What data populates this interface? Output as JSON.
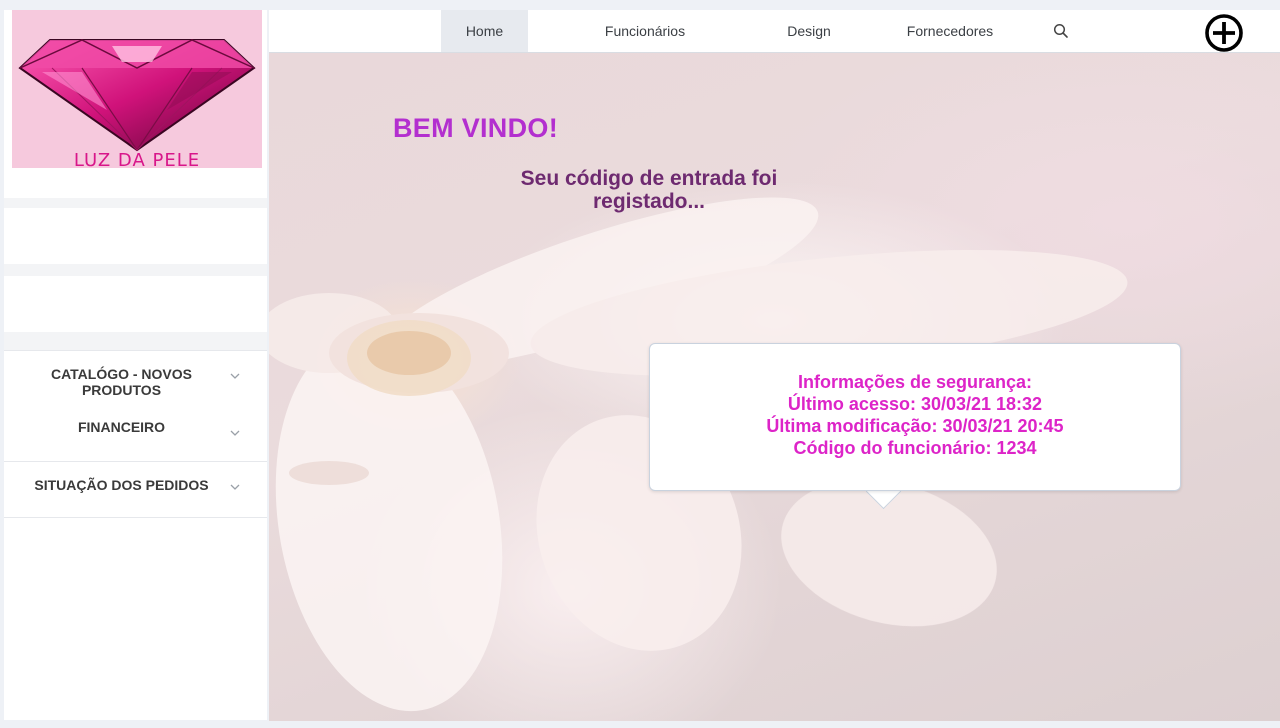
{
  "logo": {
    "text": "LUZ DA PELE"
  },
  "sidebar": {
    "items": [
      {
        "label": "CATALÓGO - NOVOS PRODUTOS"
      },
      {
        "label": "FINANCEIRO"
      },
      {
        "label": "SITUAÇÃO DOS PEDIDOS"
      }
    ]
  },
  "nav": {
    "items": [
      {
        "label": "Home",
        "active": true
      },
      {
        "label": "Funcionários"
      },
      {
        "label": "Design"
      },
      {
        "label": "Fornecedores"
      }
    ],
    "search_icon": "search-icon",
    "add_icon": "plus-circle-icon"
  },
  "main": {
    "welcome": "BEM VINDO!",
    "subtitle": "Seu código de entrada foi registado...",
    "security": {
      "heading": "Informações de segurança:",
      "last_access": "Último acesso: 30/03/21 18:32",
      "last_modification": "Última modificação: 30/03/21 20:45",
      "employee_code": "Código do funcionário: 1234"
    }
  },
  "colors": {
    "welcome": "#b32fcf",
    "subtitle": "#6e2a70",
    "security_text": "#dd24c8",
    "logo_text": "#d8168a"
  }
}
